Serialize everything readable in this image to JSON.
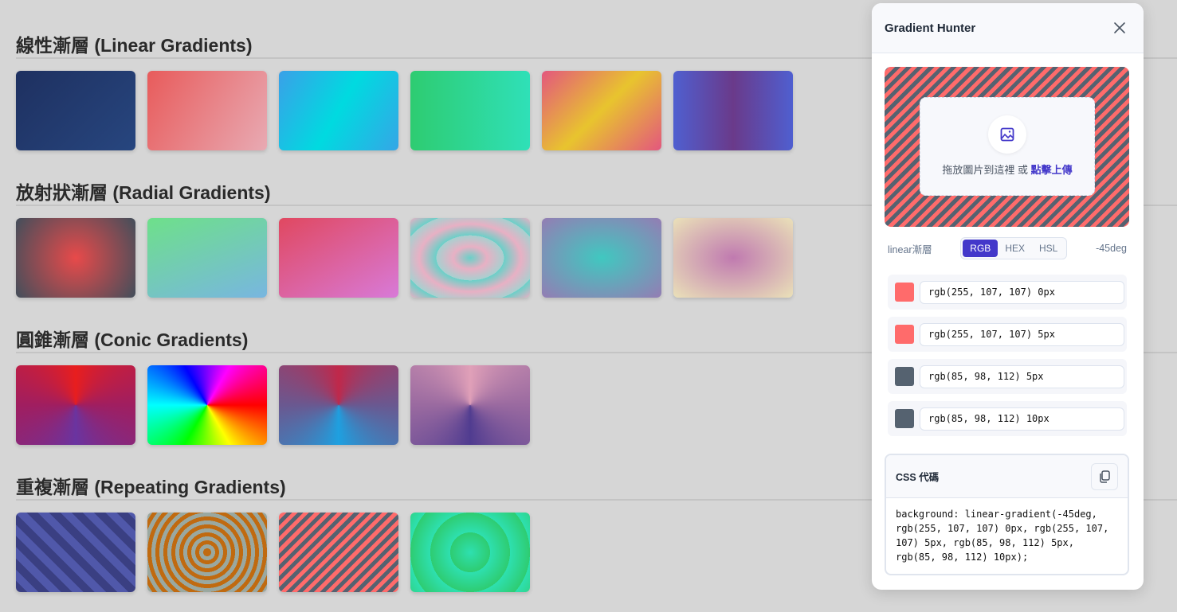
{
  "sections": [
    {
      "title": "線性漸層 (Linear Gradients)",
      "swatches": [
        "linear-gradient(135deg,#1e3060,#27467f)",
        "linear-gradient(120deg,#e85b5b,#e8aab3)",
        "linear-gradient(120deg,#3aa0e8,#00dae0 50%,#35a6e6)",
        "linear-gradient(90deg,#2ecc71,#2fe0b8)",
        "linear-gradient(135deg,#e3577e,#e8c42e 50%,#e3577e)",
        "linear-gradient(90deg,#4f5fd0,#6a3a8a 50%,#4f5fd0)"
      ]
    },
    {
      "title": "放射狀漸層 (Radial Gradients)",
      "swatches": [
        "radial-gradient(circle,#e84a4a,#4a4e5a 95%)",
        "linear-gradient(160deg,#6ee08a,#78b6e0)",
        "linear-gradient(150deg,#e04860,#d87ad8)",
        "repeating-radial-gradient(ellipse,#6ad0c8 0%,#e8b0c4 20%,#a8d0d0 40%)",
        "radial-gradient(ellipse,#40c8c0,#9080b4 95%)",
        "radial-gradient(ellipse,#c07ab0,#e8dcb8 95%)"
      ]
    },
    {
      "title": "圓錐漸層 (Conic Gradients)",
      "swatches": [
        "conic-gradient(from 0deg at 50% 50%,#e81e1e,#a01e60 25%,#6a34a0 50%,#a01e60 75%,#e81e1e)",
        "conic-gradient(from 90deg,#f00,#ff0 60deg,#0f0 120deg,#0ff 180deg,#00f 240deg,#f0f 300deg,#f00)",
        "conic-gradient(from 0deg,#c0284a,#6a5890 25%,#1ea0e0 50%,#6a5890 75%,#c0284a)",
        "conic-gradient(from 0deg,#e0a0b8,#9a6aa0 25%,#503c90 50%,#9a6aa0 75%,#e0a0b8)"
      ]
    },
    {
      "title": "重複漸層 (Repeating Gradients)",
      "swatches": [
        "repeating-linear-gradient(45deg,#3a3f82 0,#3a3f82 10px,#5058aa 10px,#5058aa 20px)",
        "repeating-radial-gradient(circle,#c06a10 0,#c06a10 5px,#9aa8a0 5px,#9aa8a0 10px)",
        "repeating-linear-gradient(-45deg,#ff6b6b 0,#ff6b6b 5px,#556270 5px,#556270 10px)",
        "repeating-radial-gradient(circle,#2ee0b0 0,#2ecc71 25px)"
      ]
    }
  ],
  "panel": {
    "title": "Gradient Hunter",
    "upload": {
      "text": "拖放圖片到這裡 或 ",
      "link": "點擊上傳"
    },
    "type_label": "linear漸層",
    "formats": [
      "RGB",
      "HEX",
      "HSL"
    ],
    "active_format": "RGB",
    "angle": "-45deg",
    "stops": [
      {
        "color": "#ff6b6b",
        "value": "rgb(255, 107, 107) 0px"
      },
      {
        "color": "#ff6b6b",
        "value": "rgb(255, 107, 107) 5px"
      },
      {
        "color": "#556270",
        "value": "rgb(85, 98, 112) 5px"
      },
      {
        "color": "#556270",
        "value": "rgb(85, 98, 112) 10px"
      }
    ],
    "css_title": "CSS 代碼",
    "css_code": "background: linear-gradient(-45deg, rgb(255, 107, 107) 0px, rgb(255, 107, 107) 5px, rgb(85, 98, 112) 5px, rgb(85, 98, 112) 10px);"
  }
}
